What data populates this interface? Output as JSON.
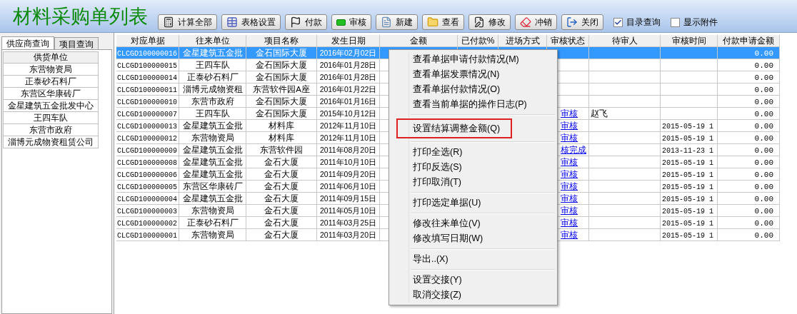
{
  "title": "材料采购单列表",
  "toolbar": [
    {
      "label": "计算全部"
    },
    {
      "label": "表格设置"
    },
    {
      "label": "付款"
    },
    {
      "label": "审核"
    },
    {
      "label": "新建"
    },
    {
      "label": "查看"
    },
    {
      "label": "修改"
    },
    {
      "label": "冲销"
    },
    {
      "label": "关闭"
    }
  ],
  "options": [
    {
      "label": "目录查询",
      "checked": true
    },
    {
      "label": "显示附件",
      "checked": false
    }
  ],
  "side_tabs": [
    {
      "label": "供应商查询",
      "selected": true
    },
    {
      "label": "项目查询",
      "selected": false
    }
  ],
  "supplier_list": {
    "header": "供货单位",
    "items": [
      "东营物资局",
      "正泰砂石料厂",
      "东营区华康砖厂",
      "金星建筑五金批发中心",
      "王四车队",
      "东营市政府",
      "淄博元成物资租赁公司"
    ]
  },
  "table": {
    "columns": [
      "对应单据",
      "往来单位",
      "项目名称",
      "发生日期",
      "金额",
      "已付款%",
      "进场方式",
      "审核状态",
      "待审人",
      "审核时间",
      "付款申请金额"
    ],
    "rows": [
      {
        "selected": true,
        "cells": [
          "CLCGD100000016",
          "金星建筑五金批",
          "金石国际大厦",
          "2016年02月02日",
          "",
          "",
          "",
          "",
          "",
          "",
          "0.00"
        ]
      },
      {
        "selected": false,
        "cells": [
          "CLCGD100000015",
          "王四车队",
          "金石国际大厦",
          "2016年01月28日",
          "",
          "",
          "",
          "",
          "",
          "",
          "0.00"
        ]
      },
      {
        "selected": false,
        "cells": [
          "CLCGD100000014",
          "正泰砂石料厂",
          "金石国际大厦",
          "2016年01月28日",
          "",
          "",
          "",
          "",
          "",
          "",
          "0.00"
        ]
      },
      {
        "selected": false,
        "cells": [
          "CLCGD100000011",
          "淄博元成物资租",
          "东营软件园A座",
          "2016年01月22日",
          "",
          "",
          "",
          "",
          "",
          "",
          "0.00"
        ]
      },
      {
        "selected": false,
        "cells": [
          "CLCGD100000010",
          "东营市政府",
          "金石国际大厦",
          "2016年01月16日",
          "",
          "",
          "",
          "",
          "",
          "",
          "0.00"
        ]
      },
      {
        "selected": false,
        "cells": [
          "CLCGD100000007",
          "王四车队",
          "金石国际大厦",
          "2015年10月12日",
          "",
          "",
          "",
          "审核",
          "赵飞",
          "",
          "0.00"
        ]
      },
      {
        "selected": false,
        "cells": [
          "CLCGD100000013",
          "金星建筑五金批",
          "材料库",
          "2012年11月10日",
          "",
          "",
          "",
          "审核",
          "",
          "2015-05-19 1",
          "0.00"
        ]
      },
      {
        "selected": false,
        "cells": [
          "CLCGD100000012",
          "东营物资局",
          "材料库",
          "2012年11月10日",
          "",
          "",
          "",
          "审核",
          "",
          "2015-05-19 1",
          "0.00"
        ]
      },
      {
        "selected": false,
        "cells": [
          "CLCGD100000009",
          "金星建筑五金批",
          "东营软件园",
          "2011年08月20日",
          "",
          "",
          "",
          "核完成",
          "",
          "2013-11-23 1",
          "0.00"
        ]
      },
      {
        "selected": false,
        "cells": [
          "CLCGD100000008",
          "金星建筑五金批",
          "金石大厦",
          "2011年10月10日",
          "",
          "",
          "",
          "审核",
          "",
          "2015-05-19 1",
          "0.00"
        ]
      },
      {
        "selected": false,
        "cells": [
          "CLCGD100000006",
          "金星建筑五金批",
          "金石大厦",
          "2011年09月20日",
          "",
          "",
          "",
          "审核",
          "",
          "2015-05-19 1",
          "0.00"
        ]
      },
      {
        "selected": false,
        "cells": [
          "CLCGD100000005",
          "东营区华康砖厂",
          "金石大厦",
          "2011年06月10日",
          "",
          "",
          "",
          "审核",
          "",
          "2015-05-19 1",
          "0.00"
        ]
      },
      {
        "selected": false,
        "cells": [
          "CLCGD100000004",
          "金星建筑五金批",
          "金石大厦",
          "2011年09月15日",
          "",
          "",
          "",
          "审核",
          "",
          "2015-05-19 1",
          "0.00"
        ]
      },
      {
        "selected": false,
        "cells": [
          "CLCGD100000003",
          "东营物资局",
          "金石大厦",
          "2011年05月10日",
          "",
          "",
          "",
          "审核",
          "",
          "2015-05-19 1",
          "0.00"
        ]
      },
      {
        "selected": false,
        "cells": [
          "CLCGD100000002",
          "正泰砂石料厂",
          "金石大厦",
          "2011年03月25日",
          "",
          "",
          "",
          "审核",
          "",
          "2015-05-19 1",
          "0.00"
        ]
      },
      {
        "selected": false,
        "cells": [
          "CLCGD100000001",
          "东营物资局",
          "金石大厦",
          "2011年03月20日",
          "",
          "",
          "",
          "审核",
          "",
          "2015-05-19 1",
          "0.00"
        ]
      }
    ]
  },
  "context_menu": [
    [
      {
        "label": "查看单据申请付款情况(M)",
        "marked": false
      },
      {
        "label": "查看单据发票情况(N)",
        "marked": false
      },
      {
        "label": "查看单据付款情况(O)",
        "marked": false
      },
      {
        "label": "查看当前单据的操作日志(P)",
        "marked": false
      }
    ],
    [
      {
        "label": "设置结算调整金额(Q)",
        "marked": true
      }
    ],
    [
      {
        "label": "打印全选(R)",
        "marked": false
      },
      {
        "label": "打印反选(S)",
        "marked": false
      },
      {
        "label": "打印取消(T)",
        "marked": false
      }
    ],
    [
      {
        "label": "打印选定单据(U)",
        "marked": false
      }
    ],
    [
      {
        "label": "修改往来单位(V)",
        "marked": false
      },
      {
        "label": "修改填写日期(W)",
        "marked": false
      }
    ],
    [
      {
        "label": "导出..(X)",
        "marked": false
      }
    ],
    [
      {
        "label": "设置交接(Y)",
        "marked": false
      },
      {
        "label": "取消交接(Z)",
        "marked": false
      }
    ]
  ]
}
